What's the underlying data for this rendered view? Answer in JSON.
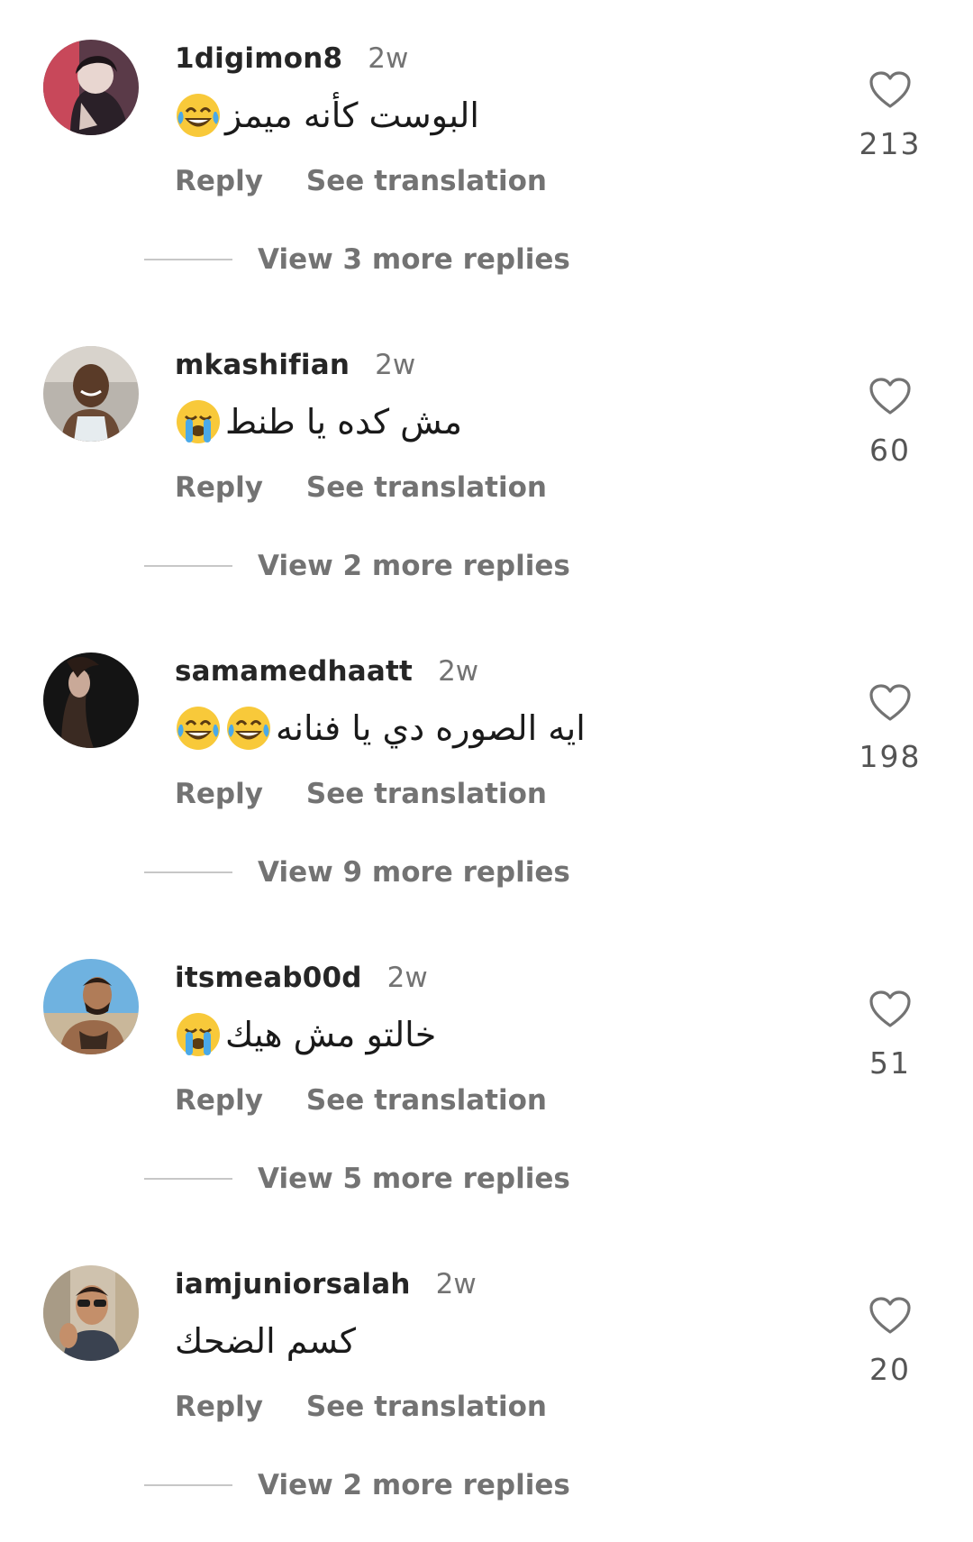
{
  "comments": [
    {
      "username": "1digimon8",
      "time": "2w",
      "text": "البوست كأنه ميمز",
      "emojis": [
        "laughing-tears"
      ],
      "reply_label": "Reply",
      "translate_label": "See translation",
      "view_replies": "View 3 more replies",
      "likes": "213"
    },
    {
      "username": "mkashifian",
      "time": "2w",
      "text": "مش كده يا طنط",
      "emojis": [
        "loudly-crying"
      ],
      "reply_label": "Reply",
      "translate_label": "See translation",
      "view_replies": "View 2 more replies",
      "likes": "60"
    },
    {
      "username": "samamedhaatt",
      "time": "2w",
      "text": "ايه الصوره دي يا فنانه",
      "emojis": [
        "laughing-tears",
        "laughing-tears"
      ],
      "reply_label": "Reply",
      "translate_label": "See translation",
      "view_replies": "View 9 more replies",
      "likes": "198"
    },
    {
      "username": "itsmeab00d",
      "time": "2w",
      "text": "خالتو مش هيك",
      "emojis": [
        "loudly-crying"
      ],
      "reply_label": "Reply",
      "translate_label": "See translation",
      "view_replies": "View 5 more replies",
      "likes": "51"
    },
    {
      "username": "iamjuniorsalah",
      "time": "2w",
      "text": "كسم الضحك",
      "emojis": [],
      "reply_label": "Reply",
      "translate_label": "See translation",
      "view_replies": "View 2 more replies",
      "likes": "20"
    }
  ],
  "icons": {
    "like": "heart-outline-icon",
    "laughing": "face-with-tears-of-joy-emoji",
    "crying": "loudly-crying-face-emoji"
  },
  "colors": {
    "username": "#262626",
    "secondary": "#737373",
    "divider": "#c7c7c7",
    "emoji_face": "#f8c93a"
  }
}
